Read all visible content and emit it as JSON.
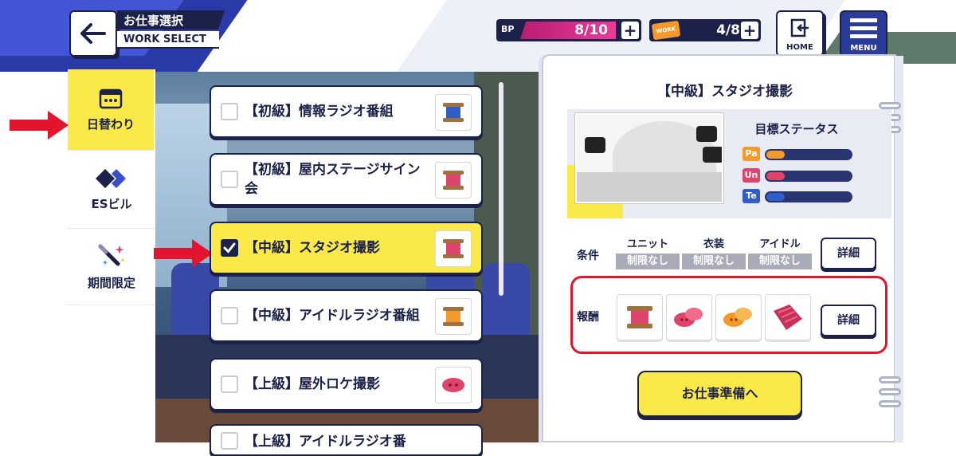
{
  "header": {
    "title_jp": "お仕事選択",
    "title_en": "WORK SELECT",
    "bp_tag": "BP",
    "bp_value": "8/10",
    "work_tag": "WORK",
    "work_value": "4/8",
    "plus": "+",
    "home_label": "HOME",
    "menu_label": "MENU"
  },
  "sidebar": {
    "items": [
      {
        "label": "日替わり"
      },
      {
        "label": "ESビル"
      },
      {
        "label": "期間限定"
      }
    ]
  },
  "works": [
    {
      "name": "【初級】情報ラジオ番組",
      "selected": false,
      "thumb_color": "#2f5ec9"
    },
    {
      "name": "【初級】屋内ステージサイン会",
      "selected": false,
      "thumb_color": "#e0446a"
    },
    {
      "name": "【中級】スタジオ撮影",
      "selected": true,
      "thumb_color": "#e0446a"
    },
    {
      "name": "【中級】アイドルラジオ番組",
      "selected": false,
      "thumb_color": "#f39a2a"
    },
    {
      "name": "【上級】屋外ロケ撮影",
      "selected": false,
      "thumb_color": "#e0446a"
    },
    {
      "name": "【上級】アイドルラジオ番",
      "selected": false,
      "thumb_color": "#2f5ec9"
    }
  ],
  "detail": {
    "title": "【中級】スタジオ撮影",
    "target_label": "目標ステータス",
    "stats": [
      {
        "key": "Pa",
        "color": "#f39a2a",
        "fill": 0.22
      },
      {
        "key": "Un",
        "color": "#e0446a",
        "fill": 0.22
      },
      {
        "key": "Te",
        "color": "#2f5ec9",
        "fill": 0.22
      }
    ],
    "conditions_label": "条件",
    "conditions": [
      {
        "head": "ユニット",
        "value": "制限なし"
      },
      {
        "head": "衣装",
        "value": "制限なし"
      },
      {
        "head": "アイドル",
        "value": "制限なし"
      }
    ],
    "detail_button": "詳細",
    "reward_label": "報酬",
    "rewards": [
      "thread-spool-pink",
      "button-pink",
      "button-orange",
      "fabric-pink"
    ],
    "prepare_button": "お仕事準備へ"
  }
}
